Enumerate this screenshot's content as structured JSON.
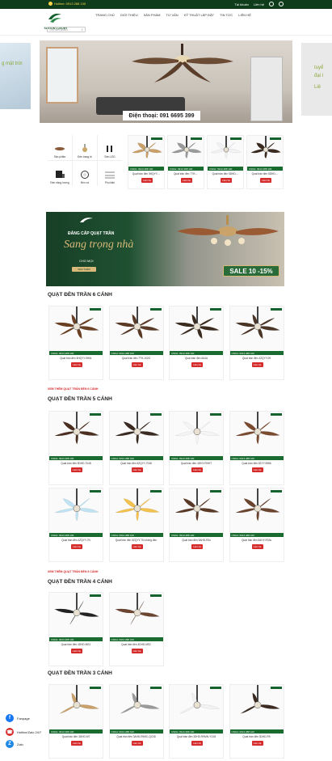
{
  "topbar": {
    "hotline": "Hotline: 0913 288 100",
    "account": "Tài khoản",
    "login": "Liên hệ"
  },
  "header": {
    "logo_text": "SAIGON LUXURY",
    "search_placeholder": "Tìm sản phẩm...",
    "nav": [
      "TRANG CHỦ",
      "GIỚI THIỆU",
      "SẢN PHẨM",
      "TƯ VẤN",
      "KỸ THUẬT LẮP ĐẶT",
      "TIN TỨC",
      "LIÊN HỆ"
    ]
  },
  "hero": {
    "phone": "Điện thoại: 091 6695 399",
    "left_side_text": "g mặt trời",
    "right_side_text": [
      "tuyể",
      "đại l",
      "Liê"
    ]
  },
  "categories": [
    {
      "label": "Sản phẩm"
    },
    {
      "label": "Đèn trang trí"
    },
    {
      "label": "Đèn LED"
    },
    {
      "label": "Đèn năng lượng"
    },
    {
      "label": "Đèn rọi"
    },
    {
      "label": "Phụ kiện"
    }
  ],
  "featured_products": [
    {
      "name": "Quạt trần đèn 5HQYY-..."
    },
    {
      "name": "Quạt trần đèn 7TH-..."
    },
    {
      "name": "Quạt trần đèn 5DHD-..."
    },
    {
      "name": "Quạt trần đèn 5DHD-..."
    }
  ],
  "buy_label": "Liên hệ",
  "hotline_strip": "CSKH: 0913 288 100",
  "banner2": {
    "top": "ĐẲNG CẤP QUẠT TRẦN",
    "big": "Sang trọng nhà",
    "sub": "CHO MỌI",
    "cta": "XEM THÊM",
    "sale": "SALE 10 -15%"
  },
  "sections": [
    {
      "title": "QUẠT ĐÈN TRẦN 6 CÁNH",
      "link": "",
      "products": [
        {
          "name": "Quạt trần đèn 5HQYY-9H6L"
        },
        {
          "name": "Quạt trần đèn 7TH-102G"
        },
        {
          "name": "Quạt trần đèn 6A4A"
        },
        {
          "name": "Quạt trần đèn 4ZQYY-09"
        }
      ]
    },
    {
      "title": "QUẠT ĐÈN TRẦN 5 CÁNH",
      "link": "XEM THÊM QUẠT TRẦN ĐÈN 6 CÁNH",
      "products": [
        {
          "name": "Quạt trần đèn 5DHD-7048"
        },
        {
          "name": "Quạt trần đèn 5ZQYY-7048"
        },
        {
          "name": "Quạt trần đèn 4DHY-RHHT"
        },
        {
          "name": "Quạt trần đèn 5ZYY-9986"
        },
        {
          "name": "Quạt trần đèn 4ZQYY-7N"
        },
        {
          "name": "Quạt trần đèn 5ZQYY-7N không đèn"
        },
        {
          "name": "Quạt trần đèn 5AHD-R3s"
        },
        {
          "name": "Quạt trần đèn 5AHY-R03s"
        }
      ]
    },
    {
      "title": "QUẠT ĐÈN TRẦN 4 CÁNH",
      "link": "XEM THÊM QUẠT TRẦN ĐÈN 5 CÁNH",
      "products": [
        {
          "name": "Quạt trần đèn 4DHD-MS1"
        },
        {
          "name": "Quạt trần đèn 4DHD-MS2"
        }
      ]
    },
    {
      "title": "QUẠT ĐÈN TRẦN 3 CÁNH",
      "link": "",
      "products": [
        {
          "name": "Quạt trần đèn 3DHD-M7"
        },
        {
          "name": "Quạt trần đèn 3AHD-R9MC-QC08"
        },
        {
          "name": "Quạt trần đèn 3DHD-R9MN-YC08"
        },
        {
          "name": "Quạt trần đèn 3DHD-R9"
        }
      ]
    }
  ],
  "float_contacts": [
    {
      "label": "Fanpage",
      "icon": "facebook-icon",
      "color": "#1877f2"
    },
    {
      "label": "Hotline/Zalo 24/7",
      "icon": "phone-icon",
      "color": "#d52b2b"
    },
    {
      "label": "Zalo",
      "icon": "zalo-icon",
      "color": "#1e88e5"
    }
  ],
  "colors": {
    "brand_green": "#16632f",
    "accent_red": "#d52b2b",
    "gold": "#d8b97a"
  }
}
